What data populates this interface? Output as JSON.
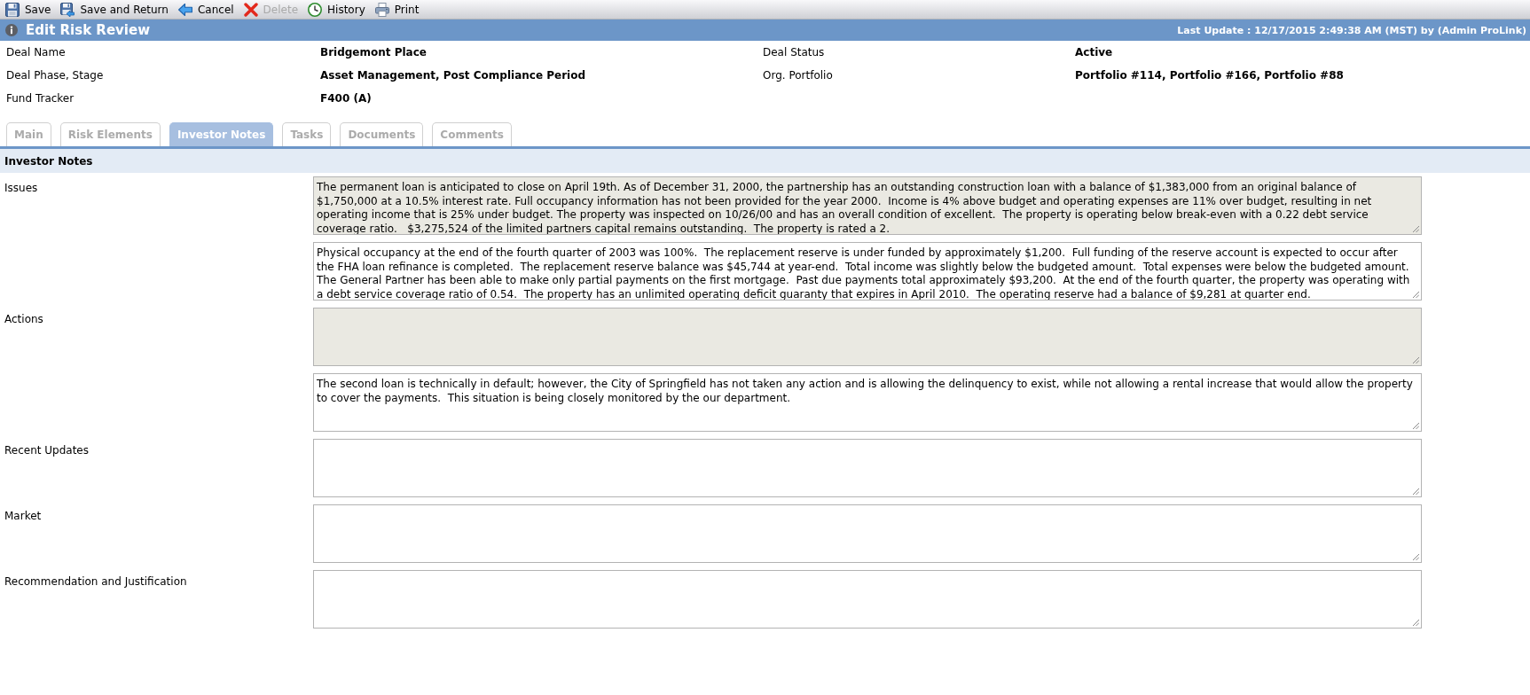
{
  "toolbar": [
    {
      "kind": "save",
      "label": "Save",
      "disabled": false
    },
    {
      "kind": "save-return",
      "label": "Save and Return",
      "disabled": false
    },
    {
      "kind": "cancel",
      "label": "Cancel",
      "disabled": false
    },
    {
      "kind": "delete",
      "label": "Delete",
      "disabled": true
    },
    {
      "kind": "history",
      "label": "History",
      "disabled": false
    },
    {
      "kind": "print",
      "label": "Print",
      "disabled": false
    }
  ],
  "header": {
    "title": "Edit Risk Review",
    "last_update": "Last Update : 12/17/2015 2:49:38 AM (MST) by (Admin ProLink)"
  },
  "deal_info": [
    {
      "label": "Deal Name",
      "value": "Bridgemont Place"
    },
    {
      "label": "Deal Status",
      "value": "Active"
    },
    {
      "label": "Deal Phase, Stage",
      "value": "Asset Management, Post Compliance Period"
    },
    {
      "label": "Org. Portfolio",
      "value": "Portfolio #114, Portfolio #166, Portfolio #88"
    },
    {
      "label": "Fund Tracker",
      "value": "F400 (A)"
    }
  ],
  "tabs": [
    {
      "label": "Main",
      "selected": false
    },
    {
      "label": "Risk Elements",
      "selected": false
    },
    {
      "label": "Investor Notes",
      "selected": true
    },
    {
      "label": "Tasks",
      "selected": false
    },
    {
      "label": "Documents",
      "selected": false
    },
    {
      "label": "Comments",
      "selected": false
    }
  ],
  "section": {
    "title": "Investor Notes",
    "fields": [
      {
        "label": "Issues",
        "boxes": [
          {
            "value": "The permanent loan is anticipated to close on April 19th. As of December 31, 2000, the partnership has an outstanding construction loan with a balance of $1,383,000 from an original balance of $1,750,000 at a 10.5% interest rate. Full occupancy information has not been provided for the year 2000.  Income is 4% above budget and operating expenses are 11% over budget, resulting in net operating income that is 25% under budget. The property was inspected on 10/26/00 and has an overall condition of excellent.  The property is operating below break-even with a 0.22 debt service coverage ratio.   $3,275,524 of the limited partners capital remains outstanding.  The property is rated a 2.",
            "readonly": true
          },
          {
            "value": "Physical occupancy at the end of the fourth quarter of 2003 was 100%.  The replacement reserve is under funded by approximately $1,200.  Full funding of the reserve account is expected to occur after the FHA loan refinance is completed.  The replacement reserve balance was $45,744 at year-end.  Total income was slightly below the budgeted amount.  Total expenses were below the budgeted amount.  The General Partner has been able to make only partial payments on the first mortgage.  Past due payments total approximately $93,200.  At the end of the fourth quarter, the property was operating with a debt service coverage ratio of 0.54.  The property has an unlimited operating deficit guaranty that expires in April 2010.  The operating reserve had a balance of $9,281 at quarter end.",
            "readonly": false
          }
        ]
      },
      {
        "label": "Actions",
        "boxes": [
          {
            "readonly": true
          },
          {
            "value": "The second loan is technically in default; however, the City of Springfield has not taken any action and is allowing the delinquency to exist, while not allowing a rental increase that would allow the property to cover the payments.  This situation is being closely monitored by the our department.",
            "readonly": false
          }
        ]
      },
      {
        "label": "Recent Updates",
        "boxes": [
          {
            "readonly": false
          }
        ]
      },
      {
        "label": "Market",
        "boxes": [
          {
            "readonly": false
          }
        ]
      },
      {
        "label": "Recommendation and Justification",
        "boxes": [
          {
            "readonly": false
          }
        ]
      }
    ]
  }
}
